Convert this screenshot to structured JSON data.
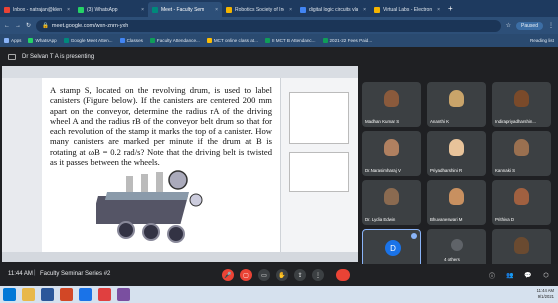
{
  "browser": {
    "tabs": [
      {
        "label": "Inbox - natrajan@klenc",
        "color": "#ea4335",
        "active": false
      },
      {
        "label": "(3) WhatsApp",
        "color": "#25d366",
        "active": false
      },
      {
        "label": "Meet - Faculty Sem",
        "color": "#00897b",
        "active": true
      },
      {
        "label": "Robotics Society of Ind",
        "color": "#f4b400",
        "active": false
      },
      {
        "label": "digital logic circuits vlab",
        "color": "#4285f4",
        "active": false
      },
      {
        "label": "Virtual Labs - Electronic",
        "color": "#f4b400",
        "active": false
      }
    ],
    "new_tab": "+",
    "url": "meet.google.com/wxn-znrn-yxh",
    "profile_label": "Paused",
    "bookmarks": [
      {
        "label": "Apps",
        "color": "#8ab4f8"
      },
      {
        "label": "WhatsApp",
        "color": "#25d366"
      },
      {
        "label": "Google Meet Atten...",
        "color": "#00897b"
      },
      {
        "label": "Classes",
        "color": "#4285f4"
      },
      {
        "label": "Faculty Attendance...",
        "color": "#0f9d58"
      },
      {
        "label": "MCT online class at...",
        "color": "#fbbc04"
      },
      {
        "label": "II MCT B Attendanc...",
        "color": "#0f9d58"
      },
      {
        "label": "2021-22 Fees Paid...",
        "color": "#0f9d58"
      }
    ],
    "reading_list": "Reading list"
  },
  "meet": {
    "presenting_label": "Dr Selvan T A is presenting",
    "document_text": "A stamp S, located on the revolving drum, is used to label canisters (Figure below). If the canisters are centered 200 mm apart on the conveyor, determine the radius rA of the driving wheel A and the radius rB of the conveyor belt drum so that for each revolution of the stamp it marks the top of a canister. How many canisters are marked per minute if the drum at B is rotating at ωB = 0.2 rad/s? Note that the driving belt is twisted as it passes between the wheels.",
    "participants": [
      {
        "name": "Madhan Kumar S",
        "face": "#8a5a3c"
      },
      {
        "name": "Ananthi K",
        "face": "#c9a46a"
      },
      {
        "name": "Indirapriyadharshin...",
        "face": "#7a4a2a"
      },
      {
        "name": "Dr.Narasimharaj V",
        "face": "#b08060"
      },
      {
        "name": "Priyadharshini R",
        "face": "#e8c39a"
      },
      {
        "name": "Kannaki S",
        "face": "#9a7050"
      },
      {
        "name": "Dr. Lydia Edwin",
        "face": "#8a6a50"
      },
      {
        "name": "Bhuvaneswari M",
        "face": "#c89060"
      },
      {
        "name": "Prithiva D",
        "face": "#a06040"
      },
      {
        "name": "Dr Selvan T A",
        "initial": "D"
      },
      {
        "name": "4 others"
      },
      {
        "name": "You",
        "face": "#6a4a30"
      }
    ],
    "time": "11:44 AM",
    "meeting_title": "Faculty Seminar Series #2"
  },
  "taskbar": {
    "clock_time": "11:44 AM",
    "clock_date": "9/1/2021"
  }
}
